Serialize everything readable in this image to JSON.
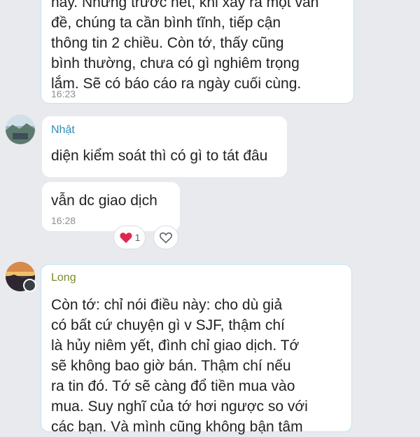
{
  "colors": {
    "background": "#e8eaed",
    "own_bubble_border": "#bfe6f6",
    "sender_nhat": "#2f8fb5",
    "sender_long": "#7a8a2c",
    "heart": "#e0284f"
  },
  "messages": [
    {
      "id": "top",
      "text": "nay. Nhưng trước hết, khi xảy ra một vấn\nđề, chúng ta cần bình tĩnh, tiếp cận\nthông tin 2 chiều. Còn tớ, thấy cũng\nbình thường, chưa có gì nghiêm trọng\nlắm. Sẽ có báo cáo ra ngày cuối cùng.",
      "time": "16:23"
    },
    {
      "id": "nhat1",
      "sender": "Nhật",
      "text": "diện kiểm soát thì có gì to tát đâu"
    },
    {
      "id": "nhat2",
      "text": "vẫn dc giao dịch",
      "time": "16:28",
      "reaction_icon": "heart-icon",
      "reaction_count": "1",
      "react_button_icon": "heart-outline-icon"
    },
    {
      "id": "long1",
      "sender": "Long",
      "text": "Còn tớ: chỉ nói điều này: cho dù giả\ncó bất cứ chuyện gì v SJF, thậm chí\nlà hủy niêm yết, đình chỉ giao dịch. Tớ\nsẽ không bao giờ bán. Thậm chí nếu\nra tin đó. Tớ sẽ càng đổ tiền mua vào\nmua. Suy nghĩ của tớ hơi ngược so với\ncác bạn. Và mình cũng không bận tâm"
    }
  ]
}
